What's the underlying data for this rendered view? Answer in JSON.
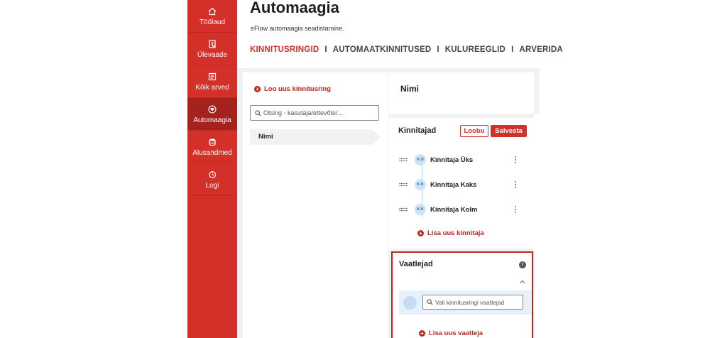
{
  "sidebar": {
    "items": [
      {
        "label": "Töölaud",
        "icon": "home-icon"
      },
      {
        "label": "Ülevaade",
        "icon": "report-icon"
      },
      {
        "label": "Kõik arved",
        "icon": "documents-icon"
      },
      {
        "label": "Automaagia",
        "icon": "heart-circle-icon",
        "active": true
      },
      {
        "label": "Alusandmed",
        "icon": "database-icon"
      },
      {
        "label": "Logi",
        "icon": "history-icon"
      }
    ]
  },
  "header": {
    "title": "Automaagia",
    "subtitle": "eFlow automaagia seadistamine.",
    "tabs": [
      {
        "label": "KINNITUSRINGID",
        "active": true
      },
      {
        "label": "AUTOMAATKINNITUSED"
      },
      {
        "label": "KULUREEGLID"
      },
      {
        "label": "ARVERIDA"
      }
    ],
    "separator": "I"
  },
  "list": {
    "add_label": "Loo uus kinnitusring",
    "search_placeholder": "Otsing - kasutaja/ettevõte/...",
    "items": [
      {
        "label": "Nimi"
      }
    ]
  },
  "detail": {
    "name_title": "Nimi",
    "approvers": {
      "title": "Kinnitajad",
      "cancel_label": "Loobu",
      "save_label": "Salvesta",
      "people": [
        {
          "initials": "K.Ü",
          "name": "Kinnitaja Üks"
        },
        {
          "initials": "K.K",
          "name": "Kinnitaja Kaks"
        },
        {
          "initials": "K.K",
          "name": "Kinnitaja Kolm"
        }
      ],
      "add_label": "Lisa uus kinnitaja"
    },
    "observers": {
      "title": "Vaatlejad",
      "search_placeholder": "Vali kinnitusringi vaatlejad",
      "add_label": "Lisa uus vaatleja"
    }
  },
  "colors": {
    "brand": "#d3302a",
    "brand_dark": "#a5231d",
    "avatar_bg": "#cfe3f7"
  }
}
